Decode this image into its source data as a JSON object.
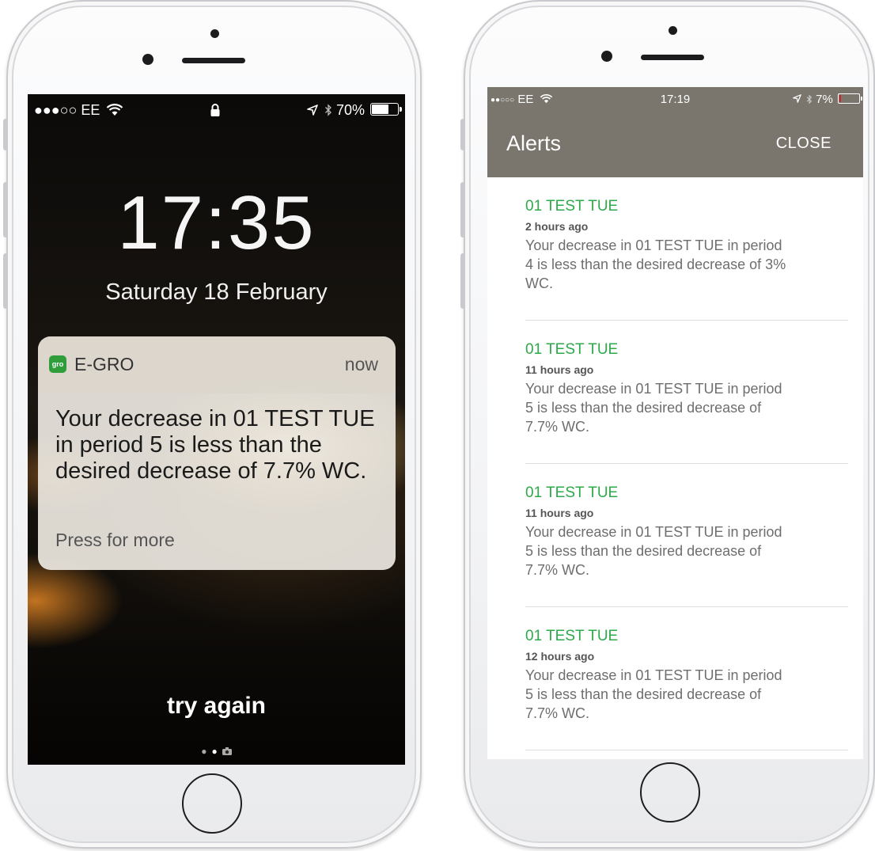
{
  "lock_screen": {
    "status_bar": {
      "signal": "●●●○○",
      "carrier": "EE",
      "lock_icon": "padlock-icon",
      "battery_percent": "70%",
      "battery_level": 0.7
    },
    "time": "17:35",
    "date": "Saturday 18 February",
    "notification": {
      "app_name": "E-GRO",
      "app_icon_label": "gro",
      "time": "now",
      "message": "Your decrease in 01 TEST TUE  in period 5 is less than the desired decrease of 7.7% WC.",
      "action": "Press for more"
    },
    "unlock_hint": "try again"
  },
  "alerts_screen": {
    "status_bar": {
      "signal": "●●○○○",
      "carrier": "EE",
      "time": "17:19",
      "battery_percent": "7%",
      "battery_level": 0.07
    },
    "header": {
      "title": "Alerts",
      "close_label": "CLOSE"
    },
    "alerts": [
      {
        "title": "01 TEST TUE",
        "age": "2 hours ago",
        "message": "Your decrease in 01 TEST TUE in period 4 is less than the desired decrease of 3% WC."
      },
      {
        "title": "01 TEST TUE",
        "age": "11 hours ago",
        "message": "Your decrease in 01 TEST TUE in period 5 is less than the desired decrease of 7.7% WC."
      },
      {
        "title": "01 TEST TUE",
        "age": "11 hours ago",
        "message": "Your decrease in 01 TEST TUE in period 5 is less than the desired decrease of 7.7% WC."
      },
      {
        "title": "01 TEST TUE",
        "age": "12 hours ago",
        "message": "Your decrease in 01 TEST TUE in period 5 is less than the desired decrease of 7.7% WC."
      }
    ]
  },
  "colors": {
    "nav_bar": "#7a766d",
    "alert_title_green": "#2ea94a",
    "app_icon_green": "#2e9d3a",
    "battery_low_red": "#e02020"
  }
}
